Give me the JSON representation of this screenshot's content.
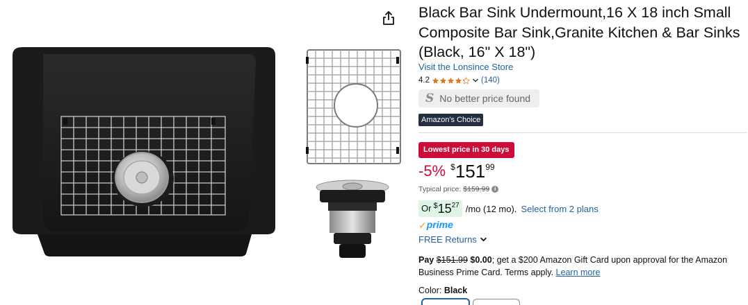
{
  "product": {
    "title": "Black Bar Sink Undermount,16 X 18 inch Small Composite Bar Sink,Granite Kitchen & Bar Sinks (Black, 16\" X 18\")",
    "store_link": "Visit the Lonsince Store",
    "rating_value": "4.2",
    "rating_stars": 4.2,
    "rating_count": "(140)",
    "no_better_price": "No better price found",
    "no_better_price_icon": "S",
    "amazons_choice": "Amazon's Choice",
    "lowest_price_badge": "Lowest price in 30 days",
    "discount": "-5%",
    "currency_symbol": "$",
    "price_whole": "151",
    "price_fraction": "99",
    "typical_label": "Typical price:",
    "typical_price": "$159.99",
    "monthly": {
      "or": "Or",
      "symbol": "$",
      "whole": "15",
      "fraction": "27",
      "per_term": "/mo (12 mo).",
      "plans_link": "Select from 2 plans"
    },
    "prime_check": "✓",
    "prime_label": "prime",
    "returns": "FREE Returns",
    "pay": {
      "pay_label": "Pay",
      "old_price": "$151.99",
      "new_price": "$0.00",
      "text": "; get a $200 Amazon Gift Card upon approval for the Amazon Business Prime Card. Terms apply.",
      "learn_more": "Learn more"
    },
    "color_label": "Color:",
    "color_value": "Black"
  },
  "icons": {
    "share": "share-icon",
    "star": "star-icon",
    "chevron": "chevron-down-icon",
    "info": "info-icon"
  },
  "colors": {
    "link": "#2162a1",
    "deal_red": "#cc0c39",
    "choice_bg": "#232f3e",
    "star": "#de7921",
    "prime_blue": "#1399ff",
    "prime_check": "#f89d1c"
  }
}
